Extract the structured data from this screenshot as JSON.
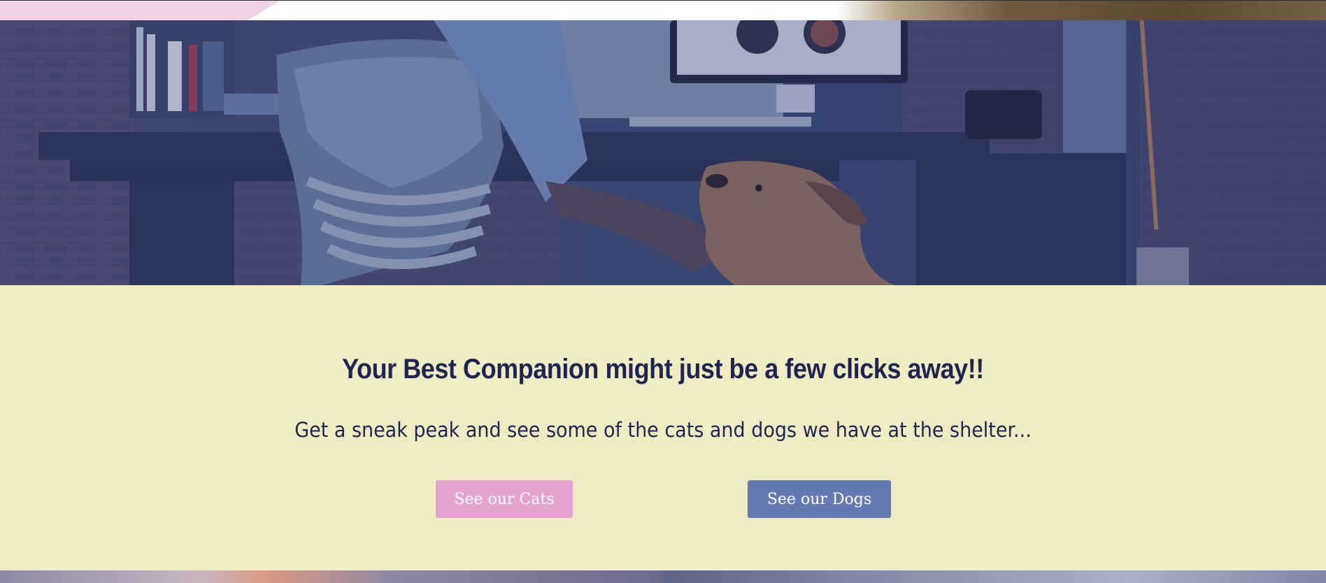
{
  "hero": {
    "image_description_icon": "hero-photo-icon"
  },
  "cta": {
    "headline": "Your Best Companion might just be a few clicks away!!",
    "subline": "Get a sneak peak and see some of the cats and dogs we have at the shelter...",
    "cats_button": "See our Cats",
    "dogs_button": "See our Dogs"
  },
  "colors": {
    "background": "#f1ebc3",
    "headline": "#1e2550",
    "cats_button": "#e5a4cf",
    "dogs_button": "#6579b3"
  }
}
